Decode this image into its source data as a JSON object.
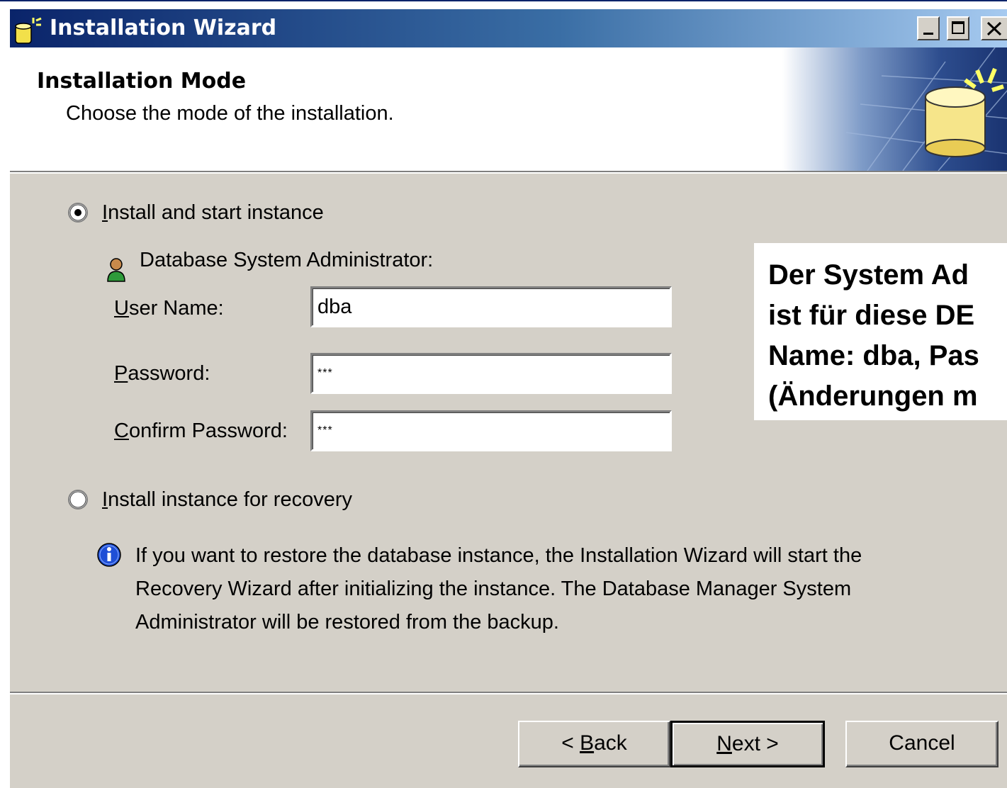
{
  "window": {
    "title": "Installation Wizard",
    "controls": [
      "minimize-icon",
      "maximize-icon",
      "close-icon"
    ]
  },
  "header": {
    "title": "Installation Mode",
    "subtitle": "Choose the mode of the installation.",
    "graphic": "database-icon"
  },
  "options": {
    "install_start": {
      "label_key": "I",
      "label_rest": "nstall and start instance",
      "selected": true
    },
    "install_recovery": {
      "label_key": "I",
      "label_rest": "nstall instance for recovery",
      "selected": false
    }
  },
  "admin": {
    "heading": "Database System Administrator:",
    "user_name": {
      "label_key": "U",
      "label_rest": "ser Name:",
      "value": "dba"
    },
    "password": {
      "label_key": "P",
      "label_rest": "assword:",
      "value": "***"
    },
    "confirm_password": {
      "label_key": "C",
      "label_rest": "onfirm Password:",
      "value": "***"
    }
  },
  "callout": {
    "text": "Der System Ad\nist für diese DE\nName: dba, Pas\n(Änderungen m"
  },
  "info": {
    "text": "If you want to restore the database instance, the Installation Wizard will start the\nRecovery Wizard after initializing the instance. The Database Manager System\nAdministrator will be restored from the backup."
  },
  "buttons": {
    "back": {
      "pre": "< ",
      "key": "B",
      "rest": "ack"
    },
    "next": {
      "pre": "",
      "key": "N",
      "rest": "ext >"
    },
    "cancel": "Cancel"
  },
  "colors": {
    "title_start": "#0a246a",
    "title_end": "#a6caf0",
    "dialog_bg": "#d4d0c8"
  }
}
